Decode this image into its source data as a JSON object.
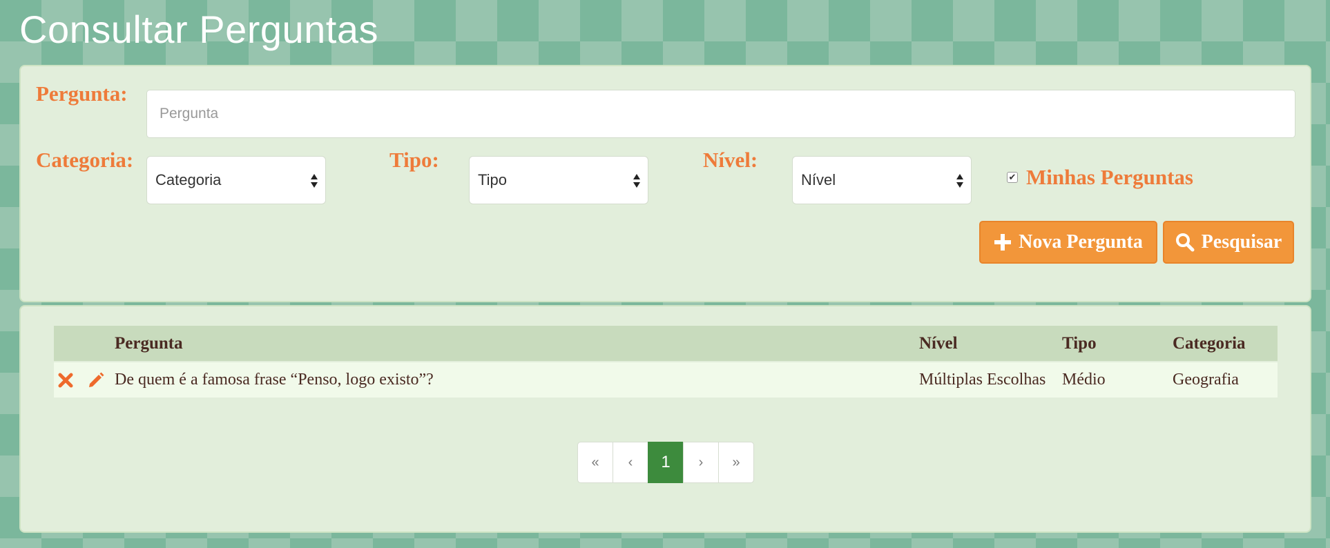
{
  "page": {
    "title": "Consultar Perguntas"
  },
  "search": {
    "pergunta_label": "Pergunta:",
    "pergunta_placeholder": "Pergunta",
    "categoria_label": "Categoria:",
    "categoria_value": "Categoria",
    "tipo_label": "Tipo:",
    "tipo_value": "Tipo",
    "nivel_label": "Nível:",
    "nivel_value": "Nível",
    "minhas_label": "Minhas Perguntas",
    "minhas_checked": true,
    "new_button": "Nova Pergunta",
    "search_button": "Pesquisar"
  },
  "table": {
    "headers": [
      "Pergunta",
      "Nível",
      "Tipo",
      "Categoria"
    ],
    "rows": [
      {
        "pergunta": "De quem é a famosa frase “Penso, logo existo”?",
        "nivel": "Múltiplas Escolhas",
        "tipo": "Médio",
        "categoria": "Geografia"
      }
    ]
  },
  "pagination": {
    "first": "«",
    "prev": "‹",
    "current": "1",
    "next": "›",
    "last": "»"
  },
  "colors": {
    "accent": "#ee7b3a",
    "button": "#f2963a",
    "active_page": "#3d8b3d",
    "background": "#7bb79c"
  },
  "icons": {
    "delete": "close-icon",
    "edit": "pencil-icon",
    "new": "plus-icon",
    "search": "search-icon",
    "select": "sort-arrows-icon"
  }
}
